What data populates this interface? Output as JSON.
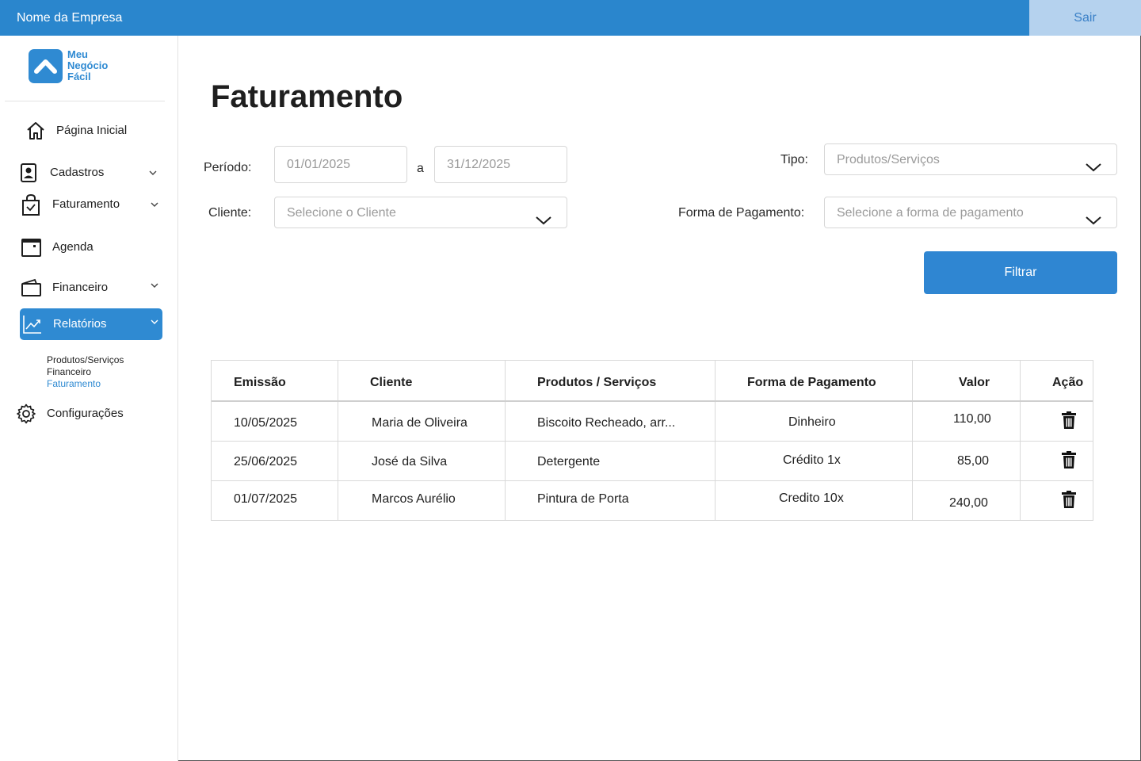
{
  "header": {
    "company_name": "Nome da Empresa",
    "logout_label": "Sair",
    "color": "#2a86cd"
  },
  "logo": {
    "line1": "Meu",
    "line2": "Negócio",
    "line3": "Fácil"
  },
  "sidebar": {
    "items": [
      {
        "label": "Página Inicial",
        "icon": "home-icon"
      },
      {
        "label": "Cadastros",
        "icon": "id-card-icon"
      },
      {
        "label": "Faturamento",
        "icon": "shopping-bag-check-icon"
      },
      {
        "label": "Agenda",
        "icon": "calendar-icon"
      },
      {
        "label": "Financeiro",
        "icon": "wallet-icon"
      },
      {
        "label": "Relatórios",
        "icon": "chart-line-icon",
        "active": true
      },
      {
        "label": "Configurações",
        "icon": "gear-icon"
      }
    ],
    "submenu": [
      "Produtos/Serviços",
      "Financeiro",
      "Faturamento"
    ],
    "submenu_active": "Faturamento",
    "active_color": "#2f8ad2"
  },
  "main": {
    "title": "Faturamento",
    "filters": {
      "period_label": "Período:",
      "period_start_placeholder": "01/01/2025",
      "period_sep": "a",
      "period_end_placeholder": "31/12/2025",
      "client_label": "Cliente:",
      "client_placeholder": "Selecione o Cliente",
      "type_label": "Tipo:",
      "type_placeholder": "Produtos/Serviços",
      "payment_label": "Forma de Pagamento:",
      "payment_placeholder": "Selecione a forma de pagamento",
      "filter_button": "Filtrar"
    },
    "table": {
      "headers": [
        "Emissão",
        "Cliente",
        "Produtos / Serviços",
        "Forma de Pagamento",
        "Valor",
        "Ação"
      ],
      "rows": [
        {
          "emissao": "10/05/2025",
          "cliente": "Maria de Oliveira",
          "produtos": "Biscoito Recheado, arr...",
          "pagamento": "Dinheiro",
          "valor": "110,00",
          "acao": "trash-icon"
        },
        {
          "emissao": "25/06/2025",
          "cliente": "José da Silva",
          "produtos": "Detergente",
          "pagamento": "Crédito 1x",
          "valor": "85,00",
          "acao": "trash-icon"
        },
        {
          "emissao": "01/07/2025",
          "cliente": "Marcos Aurélio",
          "produtos": "Pintura de Porta",
          "pagamento": "Credito 10x",
          "valor": "240,00",
          "acao": "trash-icon"
        }
      ]
    }
  }
}
